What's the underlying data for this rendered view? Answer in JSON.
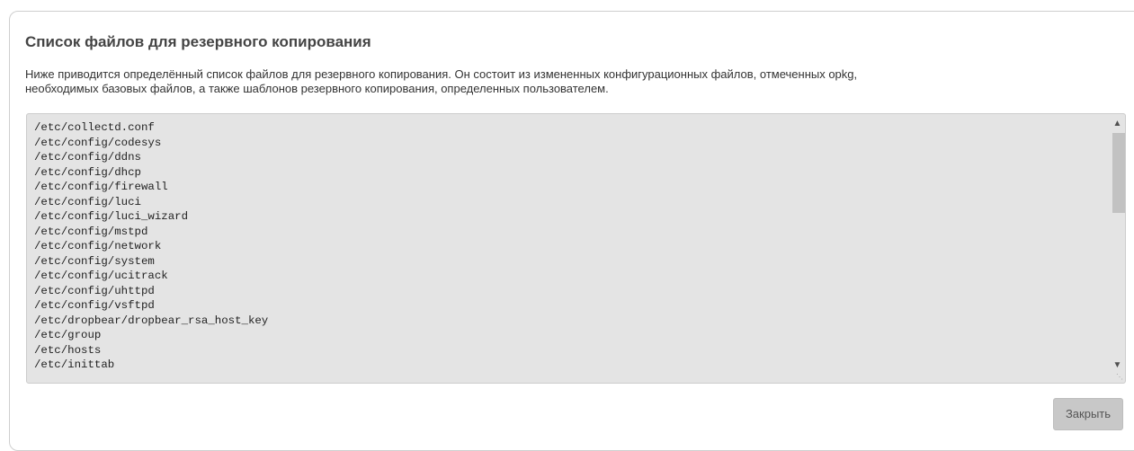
{
  "dialog": {
    "title": "Список файлов для резервного копирования",
    "description_line1": "Ниже приводится определённый список файлов для резервного копирования. Он состоит из измененных конфигурационных файлов, отмеченных opkg,",
    "description_line2": "необходимых базовых файлов, а также шаблонов резервного копирования, определенных пользователем.",
    "files": [
      "/etc/collectd.conf",
      "/etc/config/codesys",
      "/etc/config/ddns",
      "/etc/config/dhcp",
      "/etc/config/firewall",
      "/etc/config/luci",
      "/etc/config/luci_wizard",
      "/etc/config/mstpd",
      "/etc/config/network",
      "/etc/config/system",
      "/etc/config/ucitrack",
      "/etc/config/uhttpd",
      "/etc/config/vsftpd",
      "/etc/dropbear/dropbear_rsa_host_key",
      "/etc/group",
      "/etc/hosts",
      "/etc/inittab"
    ],
    "close_label": "Закрыть"
  },
  "icons": {
    "scroll_up": "chevron-up-icon",
    "scroll_down": "chevron-down-icon",
    "resize": "resize-grip-icon"
  },
  "colors": {
    "list_background": "#e4e4e4",
    "button_background": "#c8c8c8",
    "title_text": "#444444"
  }
}
